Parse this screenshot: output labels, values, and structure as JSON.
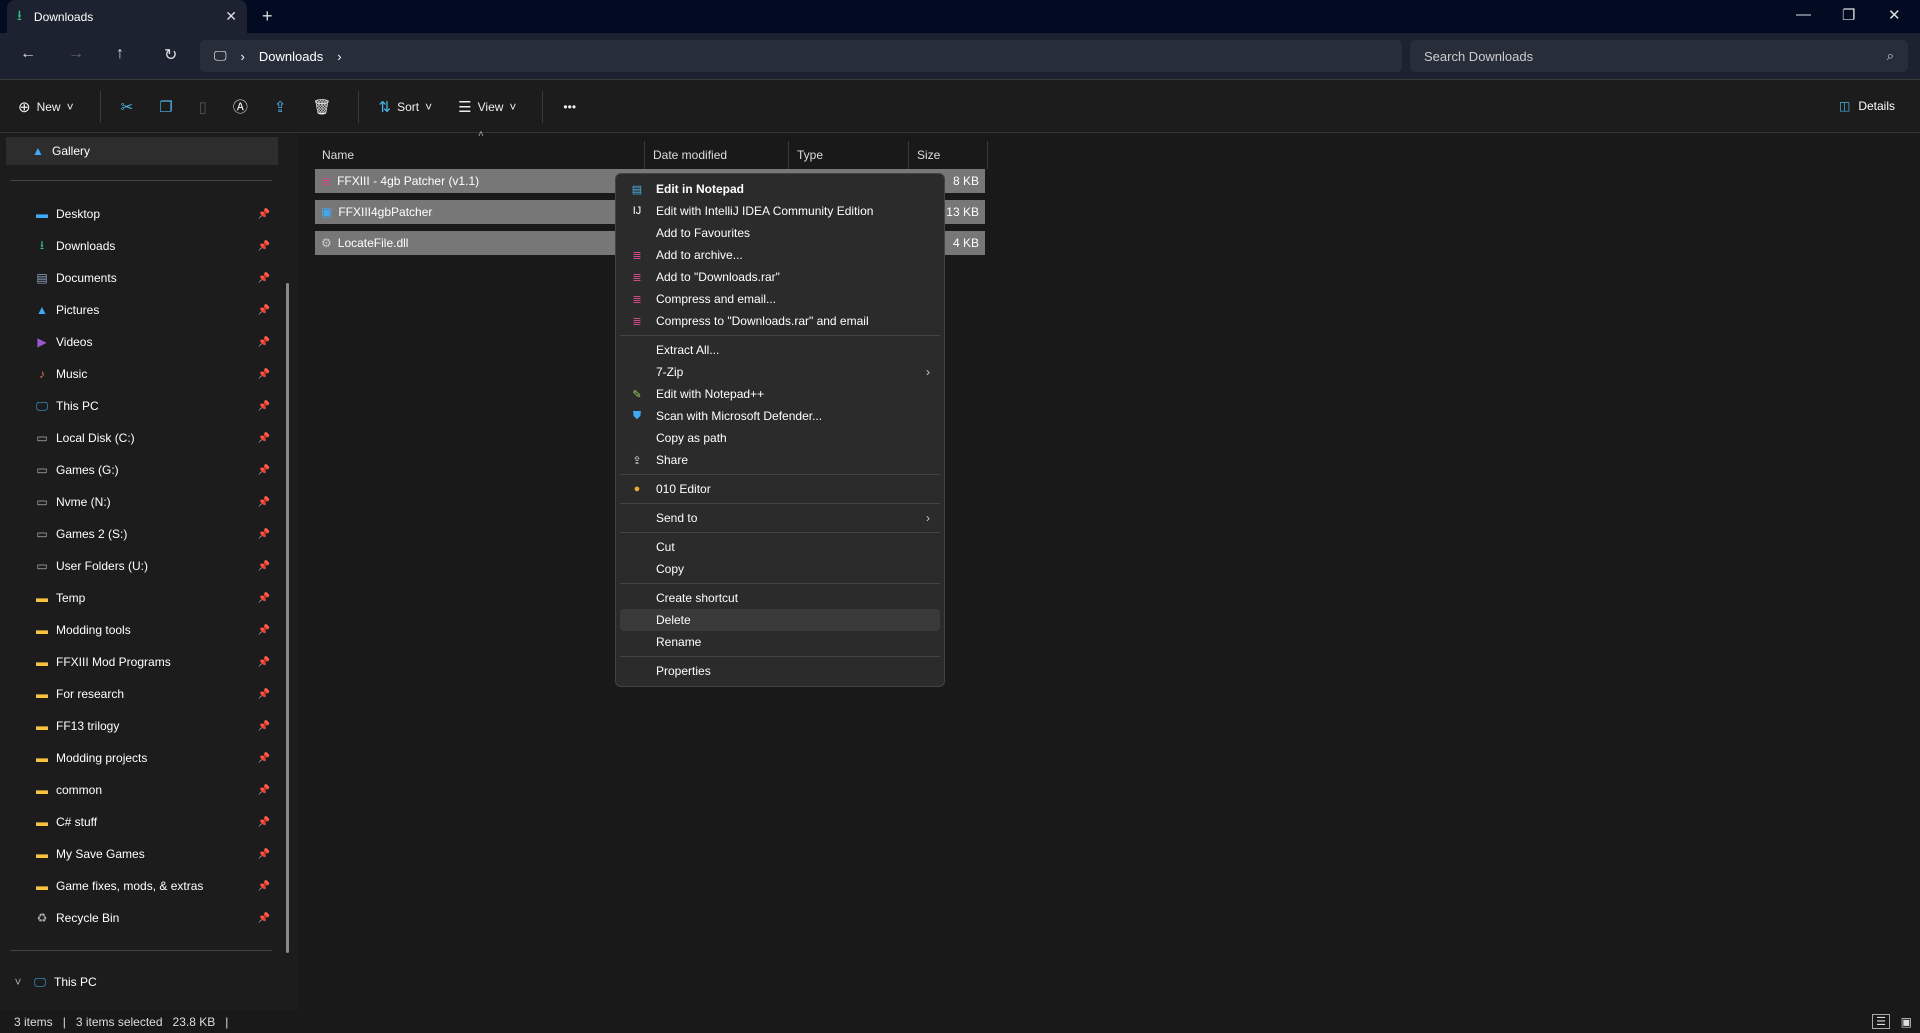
{
  "tab": {
    "title": "Downloads",
    "close": "✕",
    "new": "+"
  },
  "window": {
    "minimize": "—",
    "restore": "❐",
    "close": "✕"
  },
  "nav": {
    "back": "←",
    "forward": "→",
    "up": "↑",
    "refresh": "↻",
    "breadcrumb": [
      "Downloads"
    ],
    "search_placeholder": "Search Downloads"
  },
  "toolbar": {
    "new": "New",
    "sort": "Sort",
    "view": "View",
    "more": "•••",
    "details": "Details"
  },
  "sidebar": {
    "gallery": "Gallery",
    "items": [
      {
        "label": "Desktop",
        "icon": "desktop-icon",
        "color": "#3fa9f5"
      },
      {
        "label": "Downloads",
        "icon": "download-icon",
        "color": "#2ec27e"
      },
      {
        "label": "Documents",
        "icon": "document-icon",
        "color": "#8fa6c8"
      },
      {
        "label": "Pictures",
        "icon": "picture-icon",
        "color": "#3fa9f5"
      },
      {
        "label": "Videos",
        "icon": "video-icon",
        "color": "#9b59d0"
      },
      {
        "label": "Music",
        "icon": "music-icon",
        "color": "#e8735a"
      },
      {
        "label": "This PC",
        "icon": "pc-icon",
        "color": "#3fb8e8"
      },
      {
        "label": "Local Disk (C:)",
        "icon": "drive-icon",
        "color": "#aaa"
      },
      {
        "label": "Games (G:)",
        "icon": "drive-icon",
        "color": "#aaa"
      },
      {
        "label": "Nvme (N:)",
        "icon": "drive-icon",
        "color": "#aaa"
      },
      {
        "label": "Games 2 (S:)",
        "icon": "drive-icon",
        "color": "#aaa"
      },
      {
        "label": "User Folders (U:)",
        "icon": "drive-icon",
        "color": "#aaa"
      },
      {
        "label": "Temp",
        "icon": "folder-icon",
        "color": "#f5c242"
      },
      {
        "label": "Modding tools",
        "icon": "folder-icon",
        "color": "#f5c242"
      },
      {
        "label": "FFXIII Mod Programs",
        "icon": "folder-icon",
        "color": "#f5c242"
      },
      {
        "label": "For research",
        "icon": "folder-icon",
        "color": "#f5c242"
      },
      {
        "label": "FF13 trilogy",
        "icon": "folder-icon",
        "color": "#f5c242"
      },
      {
        "label": "Modding projects",
        "icon": "folder-icon",
        "color": "#f5c242"
      },
      {
        "label": "common",
        "icon": "folder-icon",
        "color": "#f5c242"
      },
      {
        "label": "C# stuff",
        "icon": "folder-icon",
        "color": "#f5c242"
      },
      {
        "label": "My Save Games",
        "icon": "folder-icon",
        "color": "#f5c242"
      },
      {
        "label": "Game fixes, mods, & extras",
        "icon": "folder-icon",
        "color": "#f5c242"
      },
      {
        "label": "Recycle Bin",
        "icon": "recycle-bin-icon",
        "color": "#aaa"
      }
    ],
    "this_pc": "This PC"
  },
  "columns": [
    "Name",
    "Date modified",
    "Type",
    "Size"
  ],
  "files": [
    {
      "name": "FFXIII - 4gb Patcher (v1.1)",
      "size": "8 KB",
      "icon": "rar-icon"
    },
    {
      "name": "FFXIII4gbPatcher",
      "size": "13 KB",
      "icon": "exe-icon"
    },
    {
      "name": "LocateFile.dll",
      "size": "4 KB",
      "icon": "dll-icon"
    }
  ],
  "context_menu": [
    [
      {
        "label": "Edit in Notepad",
        "bold": true,
        "icon": "notepad-icon",
        "glyph": "▤",
        "color": "#4fb3e8"
      },
      {
        "label": "Edit with IntelliJ IDEA Community Edition",
        "icon": "intellij-icon",
        "glyph": "IJ",
        "color": "#fff"
      },
      {
        "label": "Add to Favourites"
      },
      {
        "label": "Add to archive...",
        "icon": "winrar-icon",
        "glyph": "≣",
        "color": "#d04a8a"
      },
      {
        "label": "Add to \"Downloads.rar\"",
        "icon": "winrar-icon",
        "glyph": "≣",
        "color": "#d04a8a"
      },
      {
        "label": "Compress and email...",
        "icon": "winrar-icon",
        "glyph": "≣",
        "color": "#d04a8a"
      },
      {
        "label": "Compress to \"Downloads.rar\" and email",
        "icon": "winrar-icon",
        "glyph": "≣",
        "color": "#d04a8a"
      }
    ],
    [
      {
        "label": "Extract All..."
      },
      {
        "label": "7-Zip",
        "submenu": true
      },
      {
        "label": "Edit with Notepad++",
        "icon": "notepadpp-icon",
        "glyph": "✎",
        "color": "#9ccc65"
      },
      {
        "label": "Scan with Microsoft Defender...",
        "icon": "defender-icon",
        "glyph": "⛊",
        "color": "#3fa9f5"
      },
      {
        "label": "Copy as path"
      },
      {
        "label": "Share",
        "icon": "share-icon",
        "glyph": "⇪",
        "color": "#ddd"
      }
    ],
    [
      {
        "label": "010 Editor",
        "icon": "010-editor-icon",
        "glyph": "●",
        "color": "#f0a830"
      }
    ],
    [
      {
        "label": "Send to",
        "submenu": true
      }
    ],
    [
      {
        "label": "Cut"
      },
      {
        "label": "Copy"
      }
    ],
    [
      {
        "label": "Create shortcut"
      },
      {
        "label": "Delete",
        "hover": true
      },
      {
        "label": "Rename"
      }
    ],
    [
      {
        "label": "Properties"
      }
    ]
  ],
  "status": {
    "count": "3 items",
    "selected": "3 items selected",
    "size": "23.8 KB"
  }
}
